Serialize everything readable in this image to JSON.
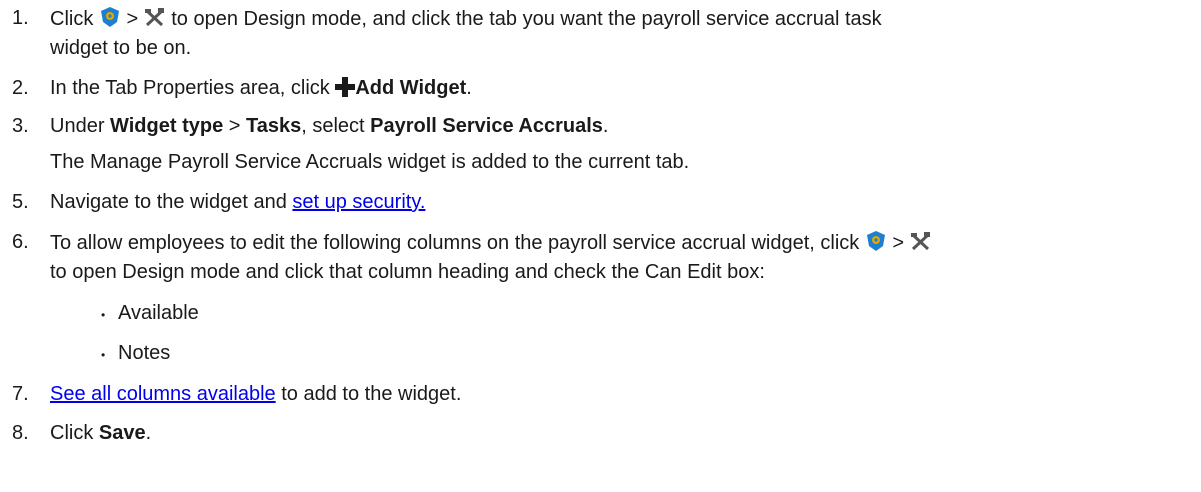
{
  "steps": [
    {
      "num": "1.",
      "line1_a": "Click ",
      "sep": " > ",
      "line1_b": " to open Design mode, and click the tab you want the payroll service accrual task",
      "line2": "widget to be on."
    },
    {
      "num": "2.",
      "text_a": "In the Tab Properties area, click ",
      "bold": "Add Widget",
      "text_b": "."
    },
    {
      "num": "3.",
      "text_a": "Under ",
      "bold1": "Widget type",
      "sep": " > ",
      "bold2": "Tasks",
      "text_b": ", select ",
      "bold3": "Payroll Service Accruals",
      "text_c": ".",
      "note": "The Manage Payroll Service Accruals widget is added to the current tab."
    },
    {
      "num": "5.",
      "text_a": "Navigate to the widget and ",
      "link": "set up security."
    },
    {
      "num": "6.",
      "line1": "To allow employees to edit the following columns on the payroll service accrual widget, click ",
      "sep": " > ",
      "line2": "to open Design mode and click that column heading and check the Can Edit box:",
      "bullets": [
        "Available",
        "Notes"
      ]
    },
    {
      "num": "7.",
      "link": "See all columns available",
      "text_a": " to add to the widget."
    },
    {
      "num": "8.",
      "text_a": "Click ",
      "bold": "Save",
      "text_b": "."
    }
  ],
  "bullet_glyph": "•",
  "colors": {
    "link": "#0000ee",
    "icon_blue": "#1e7fd0",
    "icon_gold": "#e0a800",
    "icon_gray": "#555555"
  }
}
